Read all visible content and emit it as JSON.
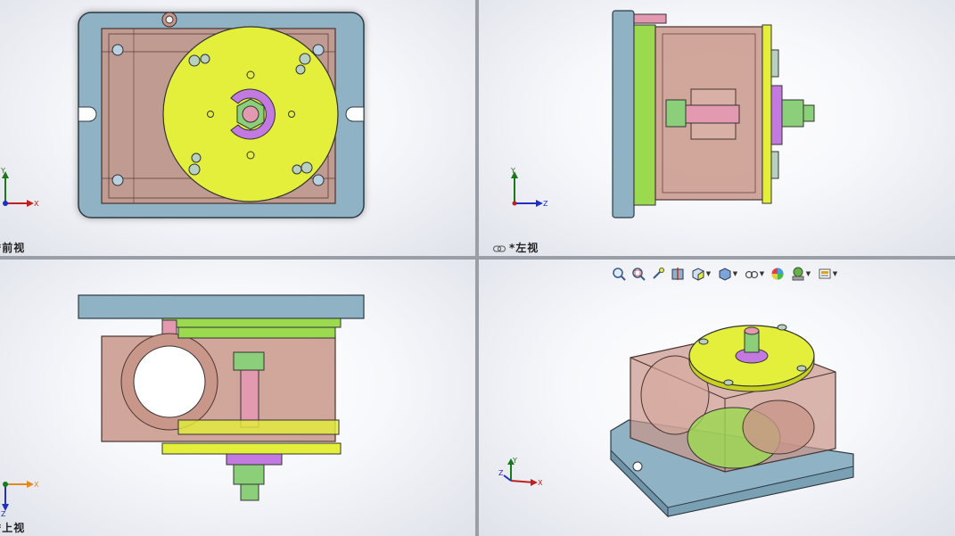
{
  "viewports": [
    {
      "id": "front",
      "label": "*前视",
      "axes": {
        "x": "X",
        "y": "Y"
      }
    },
    {
      "id": "left",
      "label": "*左视",
      "axes": {
        "x": "Z",
        "y": "Y"
      }
    },
    {
      "id": "top",
      "label": "*上视",
      "axes": {
        "x": "X",
        "y": "Z"
      }
    },
    {
      "id": "iso",
      "label": "",
      "axes": {
        "x": "X",
        "y": "Y",
        "z": "Z"
      }
    }
  ],
  "toolbar": {
    "items": [
      {
        "icon": "zoom-to-fit-icon"
      },
      {
        "icon": "zoom-to-area-icon"
      },
      {
        "icon": "previous-view-icon"
      },
      {
        "icon": "section-view-icon"
      },
      {
        "icon": "view-orientation-icon",
        "dropdown": true
      },
      {
        "icon": "display-style-icon",
        "dropdown": true
      },
      {
        "icon": "hide-show-items-icon",
        "dropdown": true
      },
      {
        "icon": "edit-appearance-icon"
      },
      {
        "icon": "apply-scene-icon",
        "dropdown": true
      },
      {
        "icon": "view-settings-icon",
        "dropdown": true
      }
    ]
  },
  "colors": {
    "plate": "#8fb2c4",
    "body": "#c9968a",
    "disc": "#e3ef3a",
    "gear": "#9bd94f",
    "rod": "#e39ab0",
    "nut": "#8bcf7a",
    "washer": "#c27ae0"
  }
}
